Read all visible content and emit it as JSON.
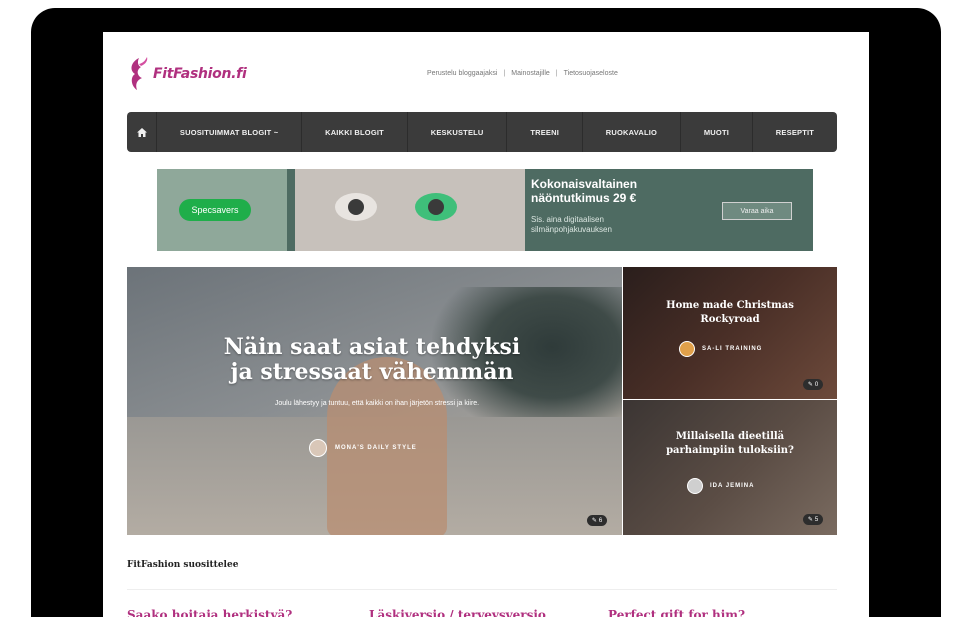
{
  "header": {
    "brand": "FitFashion.fi",
    "top_links": [
      "Perustelu bloggaajaksi",
      "Mainostajille",
      "Tietosuojaseloste"
    ],
    "top_link_separator": "|"
  },
  "nav": {
    "home_icon": "home-icon",
    "items": [
      "SUOSITUIMMAT BLOGIT ~",
      "KAIKKI BLOGIT",
      "KESKUSTELU",
      "TREENI",
      "RUOKAVALIO",
      "MUOTI",
      "RESEPTIT"
    ]
  },
  "ad": {
    "brand": "Specsavers",
    "headline_1": "Kokonaisvaltainen",
    "headline_2": "näöntutkimus 29 €",
    "sub_1": "Sis. aina digitaalisen",
    "sub_2": "silmänpohjakuvauksen",
    "button": "Varaa aika"
  },
  "hero": {
    "title_1": "Näin saat asiat tehdyksi",
    "title_2": "ja stressaat vähemmän",
    "description": "Joulu lähestyy ja tuntuu, että kaikki on ihan järjetön stressi ja kiire.",
    "author": "MONA'S DAILY STYLE",
    "comments": "6"
  },
  "side_posts": [
    {
      "title_1": "Home made Christmas",
      "title_2": "Rockyroad",
      "author": "SA-LI TRAINING",
      "comments": "0"
    },
    {
      "title_1": "Millaisella dieetillä",
      "title_2": "parhaimpiin tuloksiin?",
      "author": "IDA JEMINA",
      "comments": "5"
    }
  ],
  "recommendations": {
    "title": "FitFashion suosittelee",
    "items": [
      "Saako hoitaja herkistyä?",
      "Läskiversio / terveysversio",
      "Perfect gift for him?"
    ]
  },
  "colors": {
    "brand": "#b0307f",
    "nav": "#3b3b3b",
    "ad_accent": "#1fae4a"
  }
}
